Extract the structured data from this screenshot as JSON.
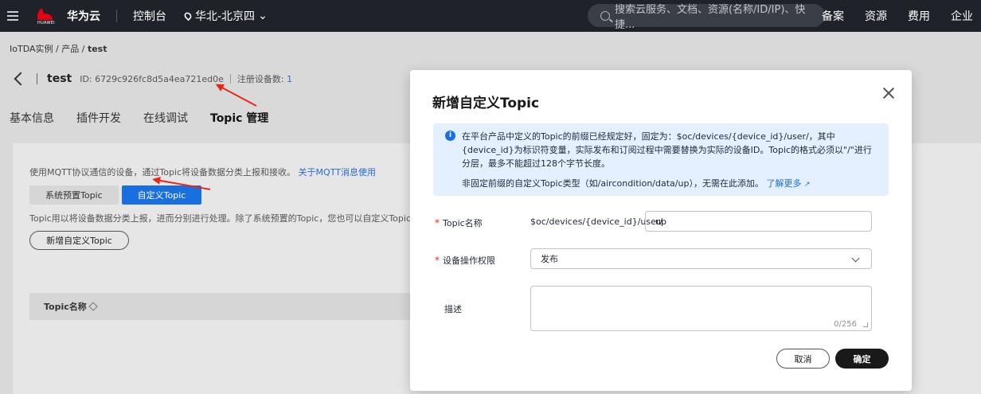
{
  "topbar": {
    "logo_text": "HUAWEI",
    "brand": "华为云",
    "console": "控制台",
    "region": "华北-北京四",
    "search_placeholder": "搜索云服务、文档、资源(名称/ID/IP)、快捷...",
    "links": [
      "备案",
      "资源",
      "费用",
      "企业"
    ]
  },
  "breadcrumb": {
    "item1": "IoTDA实例",
    "sep": "/",
    "item2": "产品",
    "item3": "test"
  },
  "product": {
    "name": "test",
    "id_label": "ID: 6729c926fc8d5a4ea721ed0e",
    "device_count_label": "注册设备数:",
    "device_count": "1"
  },
  "tabs": [
    "基本信息",
    "插件开发",
    "在线调试",
    "Topic 管理"
  ],
  "panel": {
    "hint": "使用MQTT协议通信的设备，通过Topic将设备数据分类上报和接收。",
    "hint_link": "关于MQTT消息使用",
    "seg_options": [
      "系统预置Topic",
      "自定义Topic"
    ],
    "desc": "Topic用以将设备数据分类上报，进而分别进行处理。除了系统预置的Topic，您也可以自定义Topic，然",
    "add_button": "新增自定义Topic",
    "table_header": "Topic名称"
  },
  "dialog": {
    "title": "新增自定义Topic",
    "info_p1": "在平台产品中定义的Topic的前缀已经规定好，固定为：$oc/devices/{device_id}/user/，其中{device_id}为标识符变量，实际发布和订阅过程中需要替换为实际的设备ID。Topic的格式必须以\"/\"进行分层，最多不能超过128个字节长度。",
    "info_p2": "非固定前缀的自定义Topic类型（如/aircondition/data/up），无需在此添加。",
    "info_link": "了解更多",
    "topic_label": "Topic名称",
    "topic_prefix": "$oc/devices/{device_id}/user/",
    "topic_value": "up",
    "permission_label": "设备操作权限",
    "permission_value": "发布",
    "desc_label": "描述",
    "desc_count": "0/256",
    "cancel": "取消",
    "ok": "确定"
  },
  "colors": {
    "accent": "#1a6fe0",
    "annotation_arrow": "#e8261c",
    "dark_button": "#191919"
  }
}
